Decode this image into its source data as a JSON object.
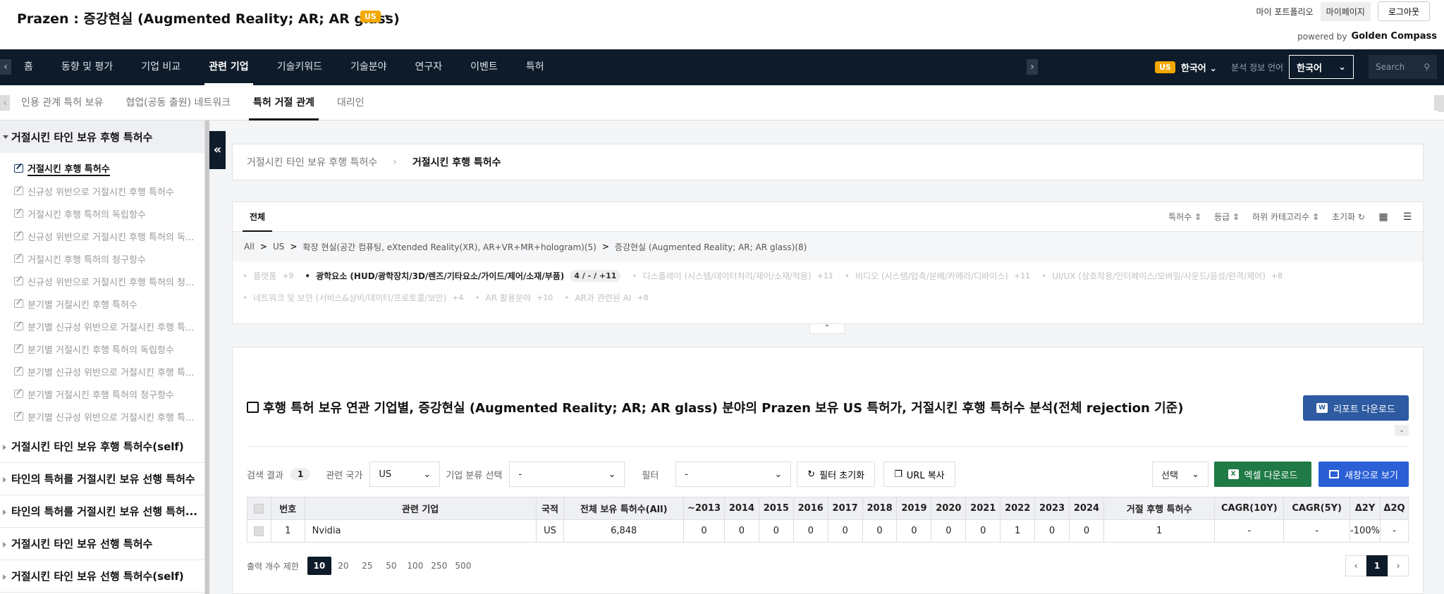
{
  "header": {
    "title": "Prazen : 증강현실 (Augmented Reality; AR; AR glass)",
    "country_badge": "US",
    "dash": "-",
    "links": [
      "마이 포트폴리오",
      "마이페이지"
    ],
    "logout": "로그아웃",
    "powered_by": "powered by",
    "brand": "Golden Compass"
  },
  "nav": {
    "items": [
      "홈",
      "동향 및 평가",
      "기업 비교",
      "관련 기업",
      "기술키워드",
      "기술분야",
      "연구자",
      "이벤트",
      "특허"
    ],
    "active_index": 3,
    "left_arrow": "‹",
    "right_arrow": "›",
    "lang_badge": "US",
    "lang_current": "한국어",
    "lang_label": "분석 정보 언어",
    "lang_select": "한국어",
    "search_placeholder": "Search"
  },
  "subtabs": {
    "items": [
      "인용 관계 특허 보유",
      "협업(공동 출원) 네트워크",
      "특허 거절 관계",
      "대리인"
    ],
    "active_index": 2
  },
  "sidebar": {
    "open_section": "거절시킨 타인 보유 후행 특허수",
    "items": [
      "거절시킨 후행 특허수",
      "신규성 위반으로 거절시킨 후행 특허수",
      "거절시킨 후행 특허의 독립항수",
      "신규성 위반으로 거절시킨 후행 특허의 독...",
      "거절시킨 후행 특허의 청구항수",
      "신규성 위반으로 거절시킨 후행 특허의 청...",
      "분기별 거절시킨 후행 특허수",
      "분기별 신규성 위반으로 거절시킨 후행 특...",
      "분기별 거절시킨 후행 특허의 독립항수",
      "분기별 신규성 위반으로 거절시킨 후행 특...",
      "분기별 거절시킨 후행 특허의 청구항수",
      "분기별 신규성 위반으로 거절시킨 후행 특..."
    ],
    "active_index": 0,
    "sections": [
      "거절시킨 타인 보유 후행 특허수(self)",
      "타인의 특허를 거절시킨 보유 선행 특허수",
      "타인의 특허를 거절시킨 보유 선행 특허...",
      "거절시킨 타인 보유 선행 특허수",
      "거절시킨 타인 보유 선행 특허수(self)"
    ],
    "collapse_label": "«"
  },
  "breadcrumb": {
    "parent": "거절시킨 타인 보유 후행 특허수",
    "sep": "›",
    "current": "거절시킨 후행 특허수"
  },
  "filter": {
    "tab": "전체",
    "sorts": [
      "특허수 ⇕",
      "등급 ⇕",
      "하위 카테고리수 ⇕",
      "초기화 ↻"
    ],
    "path": [
      "All",
      "US",
      "확장 현실(공간 컴퓨팅, eXtended Reality(XR), AR+VR+MR+hologram)(5)",
      "증강현실 (Augmented Reality; AR; AR glass)(8)"
    ],
    "path_sep": ">",
    "categories": [
      {
        "name": "플랫폼",
        "count": "+9",
        "active": false
      },
      {
        "name": "광학요소 (HUD/광학장치/3D/렌즈/기타요소/가이드/제어/소재/부품)",
        "count": "4 / - / +11",
        "active": true
      },
      {
        "name": "디스플레이 (시스템/데이터처리/제어/소재/적용)",
        "count": "+11",
        "active": false
      },
      {
        "name": "비디오 (시스템/압축/분배/카메라/디바이스)",
        "count": "+11",
        "active": false
      },
      {
        "name": "UI/UX (상호작용/인터페이스/모바일/사운드/음성/완격/제어)",
        "count": "+8",
        "active": false
      },
      {
        "name": "네트워크 및 보안 (서비스&상비/데이터/프로토콜/보안)",
        "count": "+4",
        "active": false
      },
      {
        "name": "AR 활용분야",
        "count": "+10",
        "active": false
      },
      {
        "name": "AR과 관련된 AI",
        "count": "+8",
        "active": false
      }
    ],
    "toggle": "⌃"
  },
  "result": {
    "title": "후행 특허 보유 연관 기업별, 증강현실 (Augmented Reality; AR; AR glass) 분야의 Prazen 보유 US 특허가, 거절시킨 후행 특허수 분석(전체 rejection 기준)",
    "report_btn": "리포트 다운로드",
    "search_result_label": "검색 결과",
    "search_result_count": "1",
    "country_label": "관련 국가",
    "country_value": "US",
    "company_class_label": "기업 분류 선택",
    "company_class_value": "-",
    "filter_label": "필터",
    "filter_value": "-",
    "reset_filter": "필터 초기화",
    "copy_url": "URL 복사",
    "select_label": "선택",
    "excel_btn": "엑셀 다운로드",
    "new_window_btn": "새창으로 보기",
    "excel_icon": "X",
    "word_icon": "W",
    "columns": [
      "",
      "번호",
      "관련 기업",
      "국적",
      "전체 보유 특허수(All)",
      "~2013",
      "2014",
      "2015",
      "2016",
      "2017",
      "2018",
      "2019",
      "2020",
      "2021",
      "2022",
      "2023",
      "2024",
      "거절 후행 특허수",
      "CAGR(10Y)",
      "CAGR(5Y)",
      "Δ2Y",
      "Δ2Q"
    ],
    "rows": [
      [
        "",
        "1",
        "Nvidia",
        "US",
        "6,848",
        "0",
        "0",
        "0",
        "0",
        "0",
        "0",
        "0",
        "0",
        "0",
        "1",
        "0",
        "0",
        "1",
        "-",
        "-",
        "-100%",
        "-"
      ]
    ],
    "page_size_label": "출력 개수 제한",
    "page_sizes": [
      "10",
      "20",
      "25",
      "50",
      "100",
      "250",
      "500"
    ],
    "page_size_active": 0,
    "pages": [
      "‹",
      "1",
      "›"
    ]
  }
}
